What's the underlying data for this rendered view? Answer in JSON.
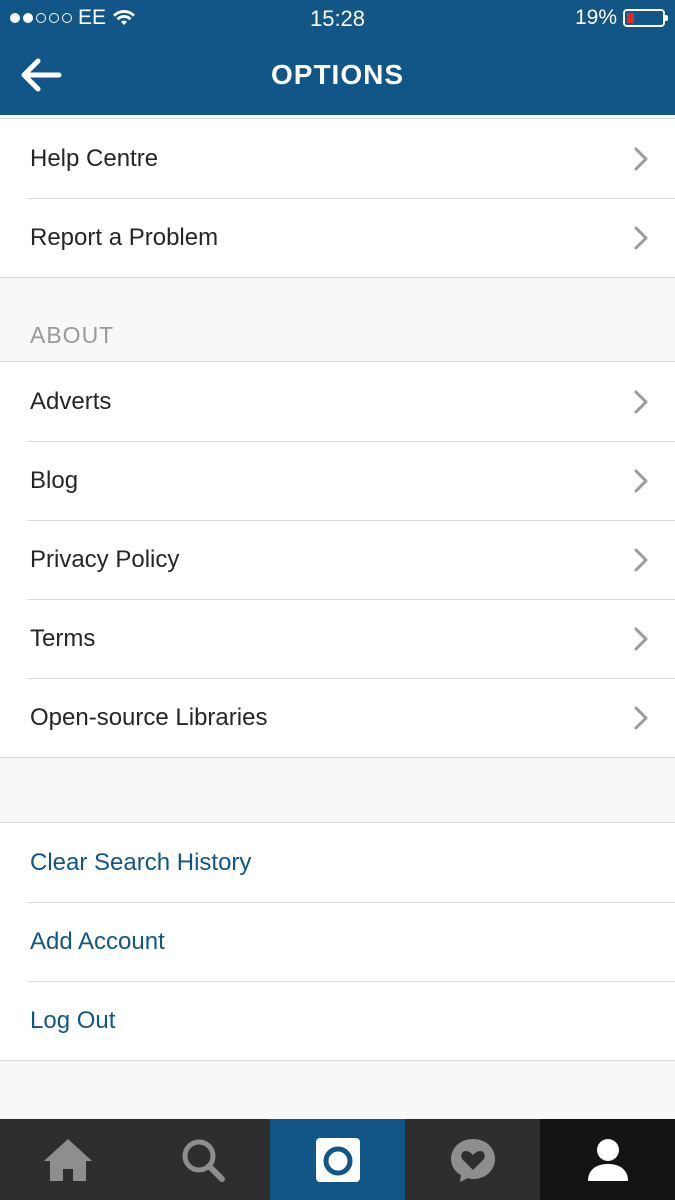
{
  "status_bar": {
    "carrier": "EE",
    "time": "15:28",
    "battery": "19%",
    "signal_dots_filled": 2,
    "signal_dots_total": 5
  },
  "header": {
    "title": "OPTIONS",
    "back_icon": "arrow-left-icon"
  },
  "support_items": [
    {
      "label": "Help Centre"
    },
    {
      "label": "Report a Problem"
    }
  ],
  "about": {
    "heading": "ABOUT",
    "items": [
      {
        "label": "Adverts"
      },
      {
        "label": "Blog"
      },
      {
        "label": "Privacy Policy"
      },
      {
        "label": "Terms"
      },
      {
        "label": "Open-source Libraries"
      }
    ]
  },
  "account_actions": [
    {
      "label": "Clear Search History"
    },
    {
      "label": "Add Account"
    },
    {
      "label": "Log Out"
    }
  ],
  "tabbar": {
    "tabs": [
      {
        "icon": "home-icon"
      },
      {
        "icon": "search-icon"
      },
      {
        "icon": "camera-icon"
      },
      {
        "icon": "activity-heart-icon"
      },
      {
        "icon": "profile-icon"
      }
    ],
    "active_index": 2
  },
  "colors": {
    "brand_blue": "#125688",
    "battery_low": "#e02a2a",
    "tabbar_bg": "#2e2e2e"
  }
}
